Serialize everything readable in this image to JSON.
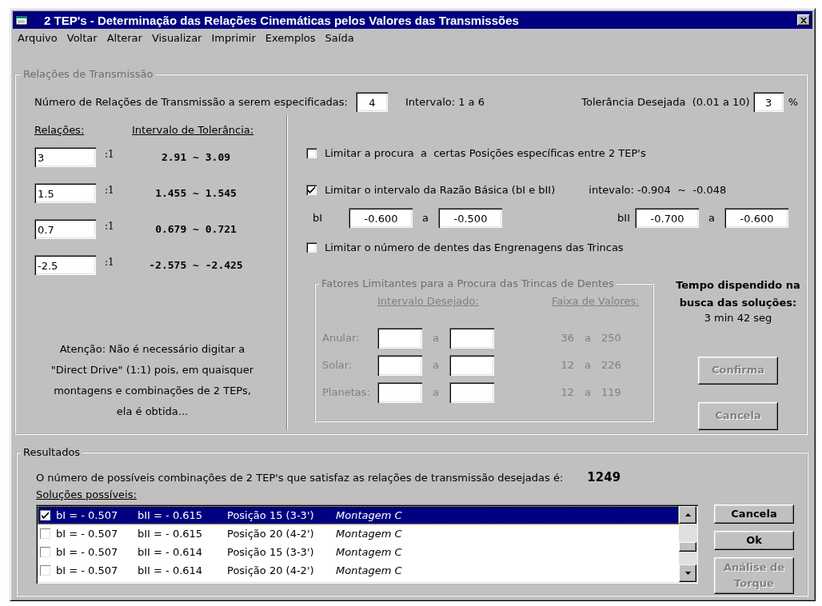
{
  "window": {
    "title": "2 TEP's - Determinação das Relações Cinemáticas pelos Valores das Transmissões"
  },
  "menu": [
    {
      "label": "Arquivo"
    },
    {
      "label": "Voltar"
    },
    {
      "label": "Alterar"
    },
    {
      "label": "Visualizar"
    },
    {
      "label": "Imprimir"
    },
    {
      "label": "Exemplos"
    },
    {
      "label": "Saída"
    }
  ],
  "transmission": {
    "title": "Relações de Transmissão",
    "title_greyed": true,
    "count_label": "Número de Relações de Transmissão a serem especificadas:",
    "count": "4",
    "range_note": "Intervalo: 1 a 6",
    "tolerance_label": "Tolerância Desejada  (0.01 a 10)",
    "tolerance": "3",
    "tolerance_unit": "%",
    "ratios_header": "Relações:",
    "tolerance_header": "Intervalo de Tolerância:",
    "ratios": [
      {
        "value": "3",
        "suffix": ":1",
        "range": "2.91 ~ 3.09"
      },
      {
        "value": "1.5",
        "suffix": ":1",
        "range": "1.455 ~ 1.545"
      },
      {
        "value": "0.7",
        "suffix": ":1",
        "range": "0.679 ~ 0.721"
      },
      {
        "value": "-2.5",
        "suffix": ":1",
        "range": "-2.575 ~ -2.425"
      }
    ],
    "note": "Atenção: Não é necessário digitar a\n\"Direct Drive\" (1:1) pois, em quaisquer\nmontagens e combinações de 2 TEPs,\nela é obtida...",
    "options": [
      {
        "label": "Limitar a procura  a  certas Posições específicas entre 2 TEP's",
        "checked": false
      },
      {
        "label": "Limitar o intervalo da Razão Básica (bI e bII)",
        "checked": true,
        "range_note": "intevalo: -0.904  ~  -0.048",
        "limits": [
          {
            "label": "bI",
            "from": "-0.600",
            "sep": "a",
            "to": "-0.500"
          },
          {
            "label": "bII",
            "from": "-0.700",
            "sep": "a",
            "to": "-0.600"
          }
        ]
      },
      {
        "label": "Limitar o número de dentes das Engrenagens das Trincas",
        "checked": false
      }
    ],
    "teeth_group": {
      "title": "Fatores Limitantes para a Procura das Trincas de Dentes",
      "disabled": true,
      "desired_header": "Intervalo Desejado:",
      "range_header": "Faixa de Valores:",
      "rows": [
        {
          "label": "Anular:",
          "sep": "a",
          "min": "36",
          "range_sep": "a",
          "max": "250"
        },
        {
          "label": "Solar:",
          "sep": "a",
          "min": "12",
          "range_sep": "a",
          "max": "226"
        },
        {
          "label": "Planetas:",
          "sep": "a",
          "min": "12",
          "range_sep": "a",
          "max": "119"
        }
      ]
    },
    "time": {
      "label": "Tempo dispendido na\nbusca das soluções:",
      "value": "3 min  42 seg"
    },
    "buttons": [
      {
        "label": "Confirma",
        "disabled": true
      },
      {
        "label": "Cancela",
        "disabled": true
      }
    ]
  },
  "results": {
    "title": "Resultados",
    "summary": "O número de possíveis combinações de 2 TEP's que satisfaz as relações de transmissão desejadas é:",
    "count": "1249",
    "list_label": "Soluções possíveis:",
    "rows": [
      {
        "bI": "bI = - 0.507",
        "bII": "bII = - 0.615",
        "position": "Posição 15 (3-3')",
        "assembly": "Montagem C",
        "checked": true,
        "selected": true
      },
      {
        "bI": "bI = - 0.507",
        "bII": "bII = - 0.615",
        "position": "Posição 20 (4-2')",
        "assembly": "Montagem C",
        "checked": false,
        "selected": false
      },
      {
        "bI": "bI = - 0.507",
        "bII": "bII = - 0.614",
        "position": "Posição 15 (3-3')",
        "assembly": "Montagem C",
        "checked": false,
        "selected": false
      },
      {
        "bI": "bI = - 0.507",
        "bII": "bII = - 0.614",
        "position": "Posição 20 (4-2')",
        "assembly": "Montagem C",
        "checked": false,
        "selected": false
      }
    ],
    "buttons": [
      {
        "label": "Cancela",
        "disabled": false
      },
      {
        "label": "Ok",
        "disabled": false
      },
      {
        "label": "Análise de\nTorque",
        "disabled": true
      }
    ]
  }
}
